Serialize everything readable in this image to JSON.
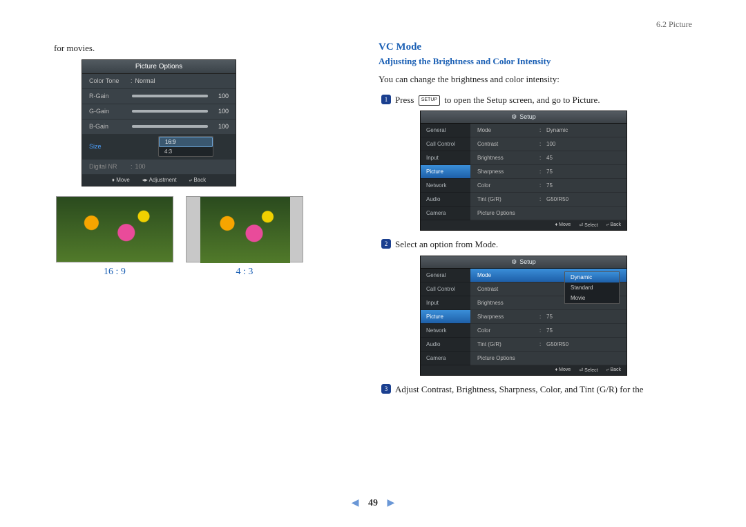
{
  "header": {
    "section": "6.2 Picture"
  },
  "left": {
    "lead": "for movies.",
    "po": {
      "title": "Picture Options",
      "rows": [
        {
          "label": "Color Tone",
          "text": "Normal"
        },
        {
          "label": "R-Gain",
          "value": "100"
        },
        {
          "label": "G-Gain",
          "value": "100"
        },
        {
          "label": "B-Gain",
          "value": "100"
        }
      ],
      "size_label": "Size",
      "size_options": [
        "16:9",
        "4:3"
      ],
      "nr_label": "Digital NR",
      "nr_value": "100",
      "footer": {
        "move": "Move",
        "adjust": "Adjustment",
        "back": "Back"
      }
    },
    "ratio_a": "16 : 9",
    "ratio_b": "4 : 3"
  },
  "right": {
    "h1": "VC Mode",
    "h2": "Adjusting the Brightness and Color Intensity",
    "intro": "You can change the brightness and color intensity:",
    "step1_a": "Press",
    "step1_key": "SETUP",
    "step1_b": "to open the Setup screen, and go to Picture.",
    "setup": {
      "title": "Setup",
      "side": [
        "General",
        "Call Control",
        "Input",
        "Picture",
        "Network",
        "Audio",
        "Camera"
      ],
      "rows": [
        {
          "k": "Mode",
          "v": "Dynamic"
        },
        {
          "k": "Contrast",
          "v": "100"
        },
        {
          "k": "Brightness",
          "v": "45"
        },
        {
          "k": "Sharpness",
          "v": "75"
        },
        {
          "k": "Color",
          "v": "75"
        },
        {
          "k": "Tint (G/R)",
          "v": "G50/R50"
        },
        {
          "k": "Picture Options",
          "v": ""
        }
      ],
      "footer": {
        "move": "Move",
        "select": "Select",
        "back": "Back"
      }
    },
    "step2": "Select an option from Mode.",
    "mode_options": [
      "Dynamic",
      "Standard",
      "Movie"
    ],
    "step3": "Adjust Contrast, Brightness, Sharpness, Color, and Tint (G/R) for the"
  },
  "pagenum": "49"
}
